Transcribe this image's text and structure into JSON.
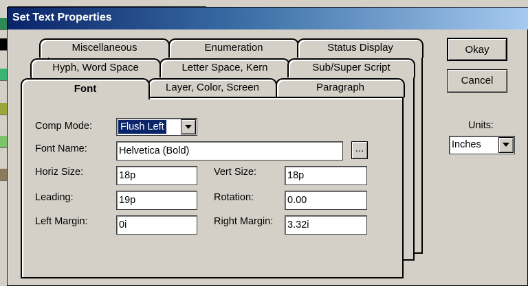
{
  "dialog": {
    "title": "Set Text Properties"
  },
  "tabs": {
    "row1": [
      "Miscellaneous",
      "Enumeration",
      "Status Display"
    ],
    "row2": [
      "Hyph, Word Space",
      "Letter Space, Kern",
      "Sub/Super Script"
    ],
    "row3": [
      "Font",
      "Layer, Color, Screen",
      "Paragraph"
    ],
    "active": "Font"
  },
  "form": {
    "comp_mode_label": "Comp Mode:",
    "comp_mode_value": "Flush Left",
    "font_name_label": "Font Name:",
    "font_name_value": "Helvetica (Bold)",
    "browse_label": "...",
    "horiz_size_label": "Horiz Size:",
    "horiz_size_value": "18p",
    "vert_size_label": "Vert Size:",
    "vert_size_value": "18p",
    "leading_label": "Leading:",
    "leading_value": "19p",
    "rotation_label": "Rotation:",
    "rotation_value": "0.00",
    "left_margin_label": "Left Margin:",
    "left_margin_value": "0i",
    "right_margin_label": "Right Margin:",
    "right_margin_value": "3.32i"
  },
  "buttons": {
    "okay": "Okay",
    "cancel": "Cancel"
  },
  "units": {
    "label": "Units:",
    "value": "Inches"
  },
  "colors": {
    "title_gradient_start": "#0a246a",
    "title_gradient_end": "#a6caf0",
    "dialog_face": "#d4d0c8",
    "selection_highlight": "#0a246a"
  }
}
